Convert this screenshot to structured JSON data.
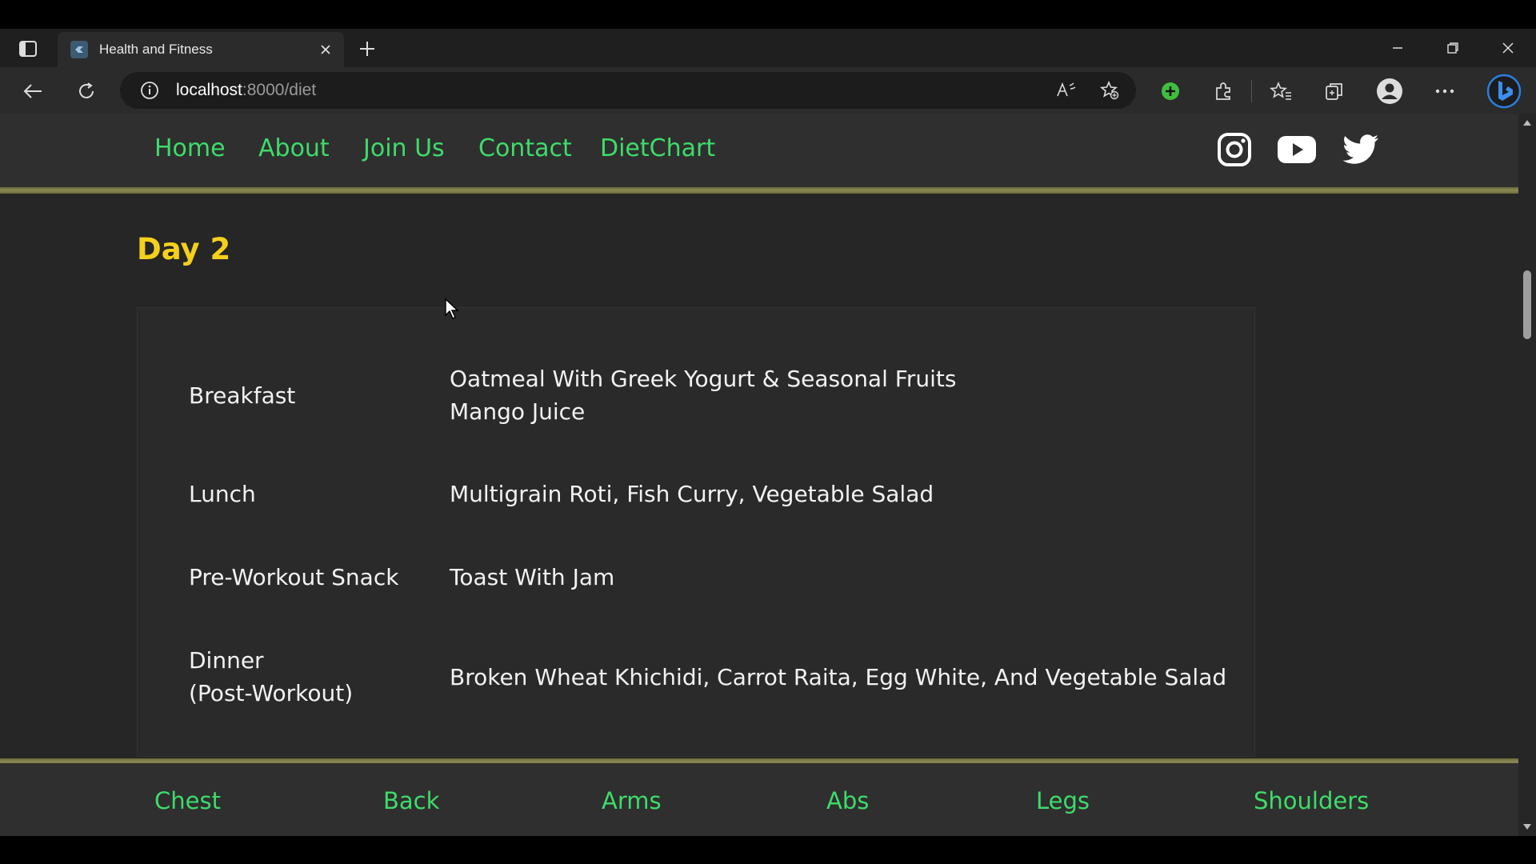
{
  "browser": {
    "tab_title": "Health and Fitness",
    "url_host": "localhost",
    "url_path": ":8000/diet"
  },
  "nav": {
    "links": [
      "Home",
      "About",
      "Join Us",
      "Contact",
      "DietChart"
    ],
    "social_icons": [
      "instagram-icon",
      "youtube-icon",
      "twitter-icon"
    ]
  },
  "diet": {
    "day_title": "Day 2",
    "meals": [
      {
        "name": "Breakfast",
        "items": [
          "Oatmeal With Greek Yogurt & Seasonal Fruits",
          "Mango Juice"
        ]
      },
      {
        "name": "Lunch",
        "items": [
          "Multigrain Roti, Fish Curry, Vegetable Salad"
        ]
      },
      {
        "name": "Pre-Workout Snack",
        "items": [
          "Toast With Jam"
        ]
      },
      {
        "name_lines": [
          "Dinner",
          "(Post-Workout)"
        ],
        "items": [
          "Broken Wheat Khichidi, Carrot Raita, Egg White, And Vegetable Salad"
        ]
      }
    ]
  },
  "footer": {
    "links": [
      "Chest",
      "Back",
      "Arms",
      "Abs",
      "Legs",
      "Shoulders"
    ]
  },
  "colors": {
    "link_green": "#3ddc6a",
    "title_yellow": "#f5d01a",
    "gold_bar": "#8b8a55"
  }
}
